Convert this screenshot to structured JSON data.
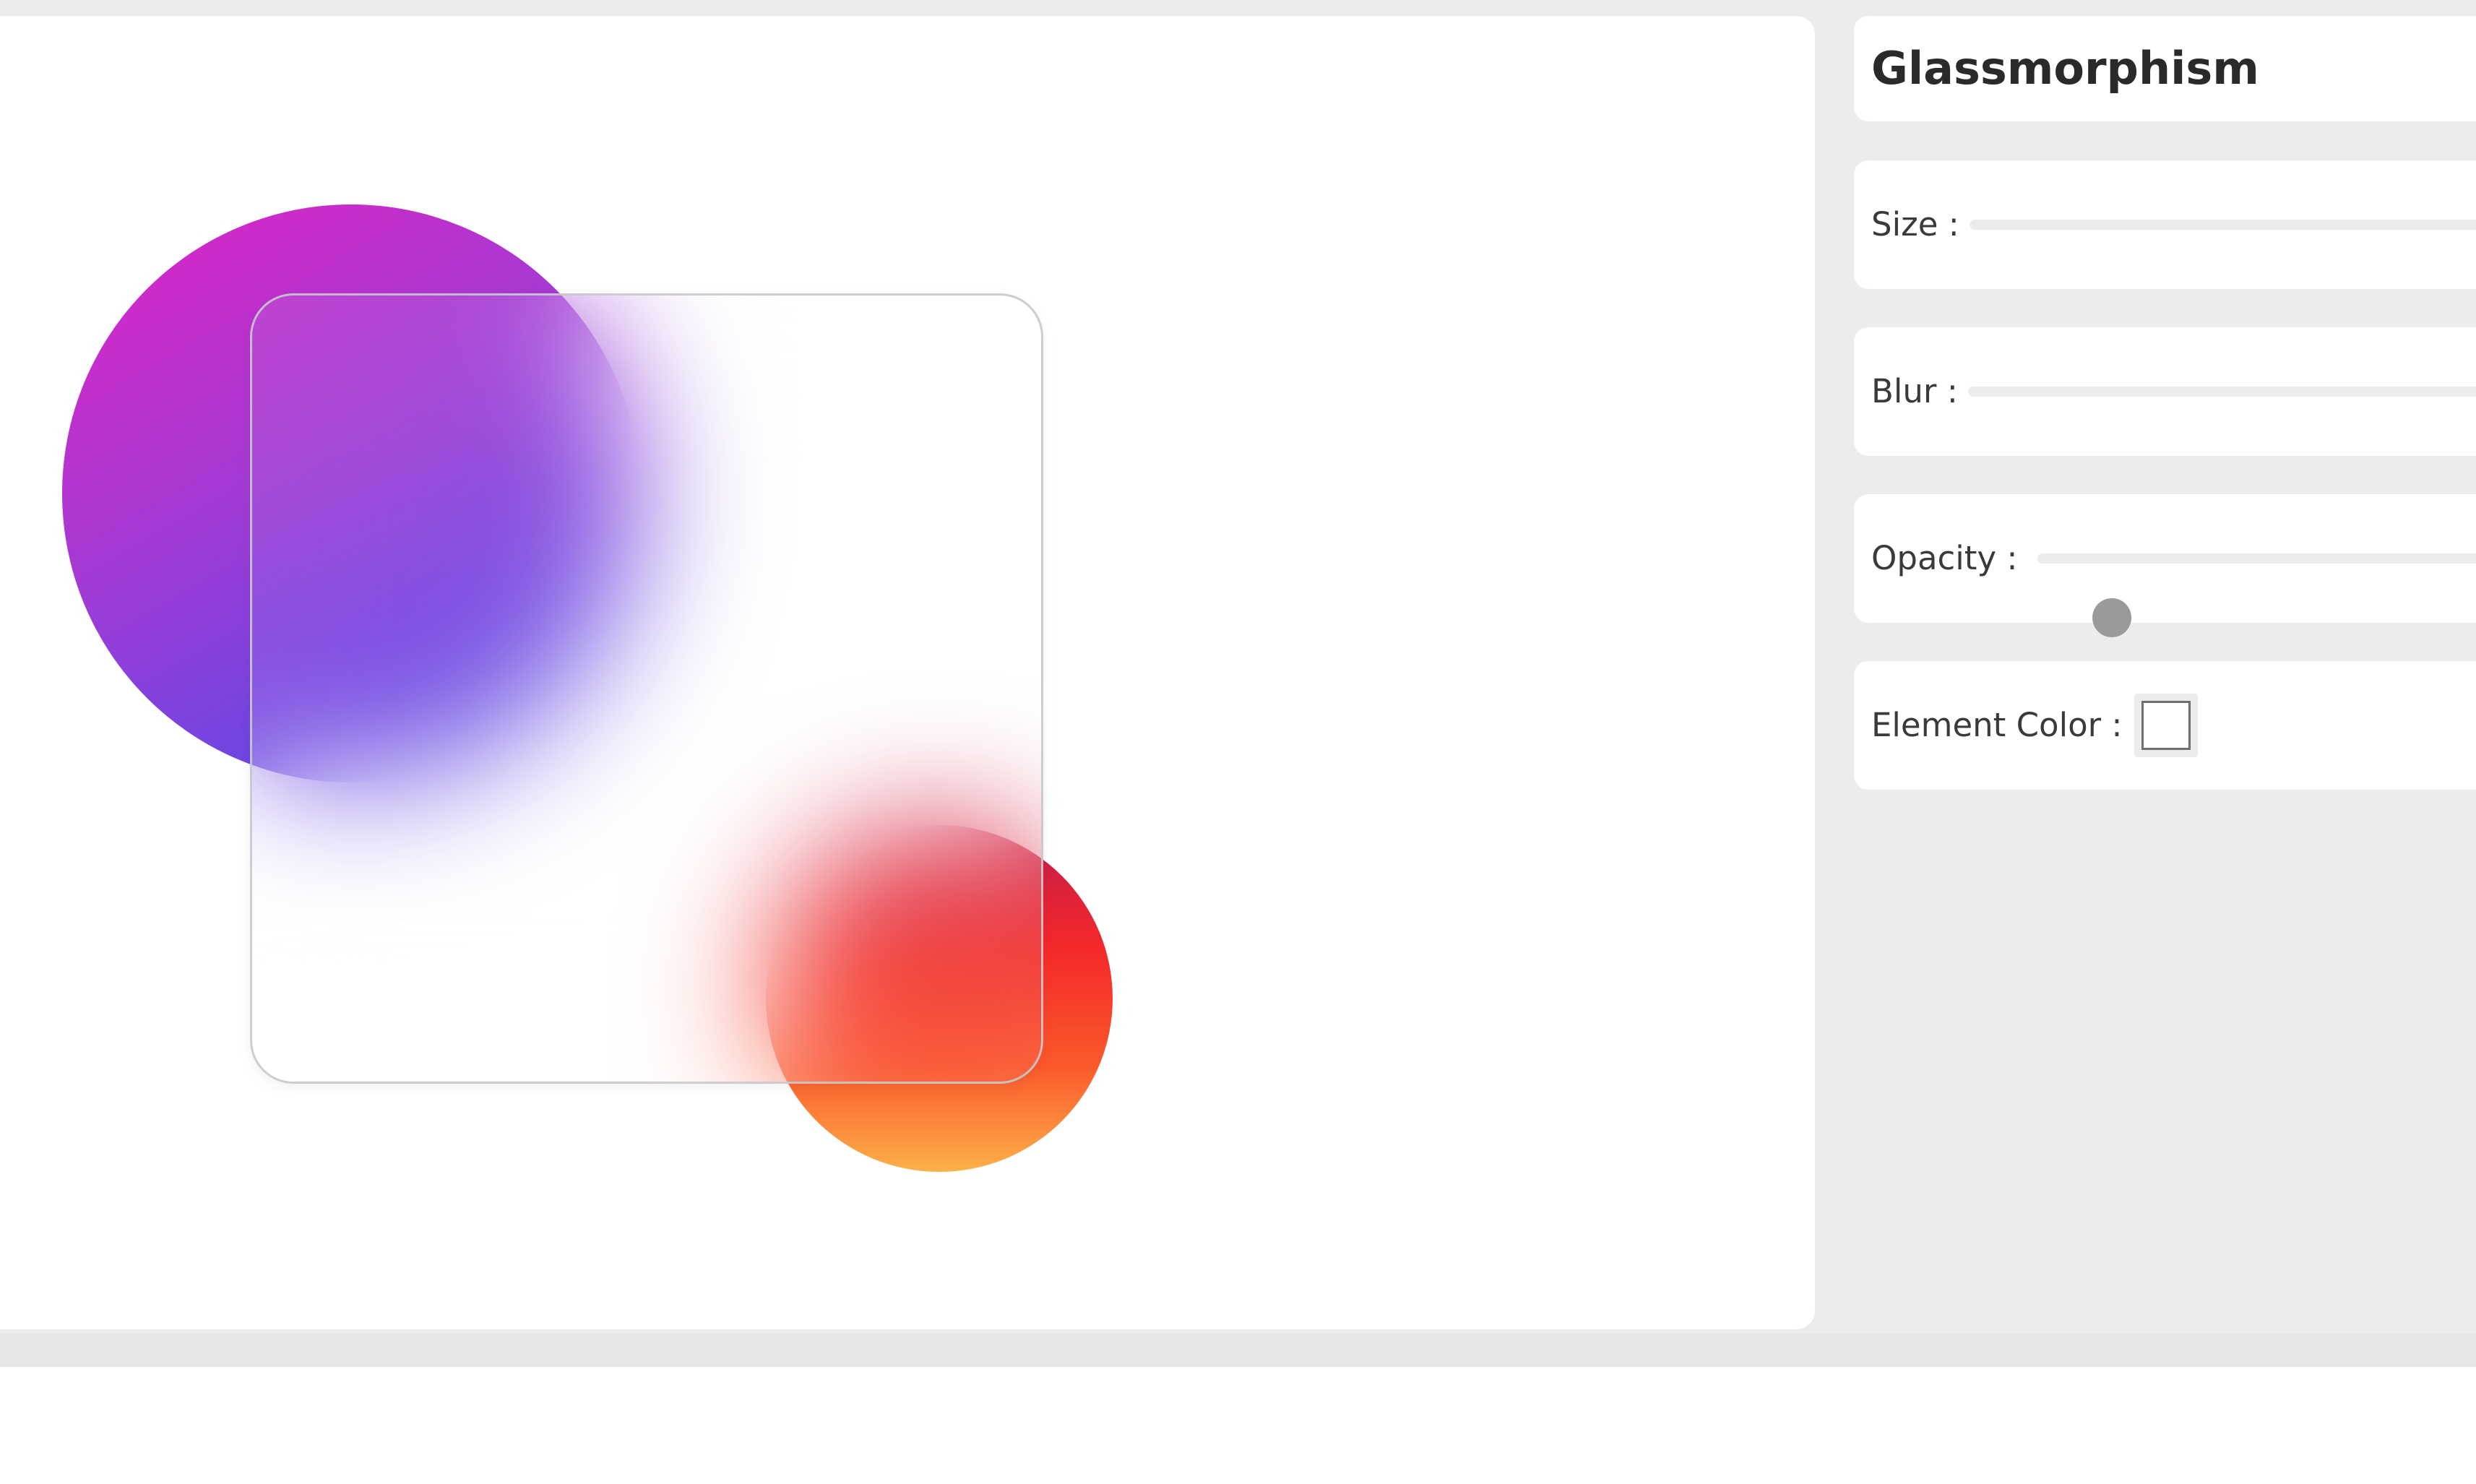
{
  "panel": {
    "title": "Glassmorphism"
  },
  "controls": {
    "size": {
      "label": "Size :"
    },
    "blur": {
      "label": "Blur :"
    },
    "opacity": {
      "label": "Opacity :",
      "value_fraction": 0.16
    },
    "element_color": {
      "label": "Element Color :",
      "value": "#ffffff"
    }
  },
  "preview": {
    "purple_circle_gradient": [
      "#e023c4",
      "#a43ad4",
      "#6a46e3",
      "#5850e8"
    ],
    "orange_circle_gradient": [
      "#c21a4c",
      "#f4282a",
      "#fb5a2b",
      "#fdb04a"
    ],
    "glass_fill": "#ffffff"
  },
  "colors": {
    "app_background": "#ececec",
    "card_background": "#ffffff",
    "slider_track": "#ececec",
    "slider_thumb": "#9a9a9a",
    "text": "#2a2a2a"
  }
}
